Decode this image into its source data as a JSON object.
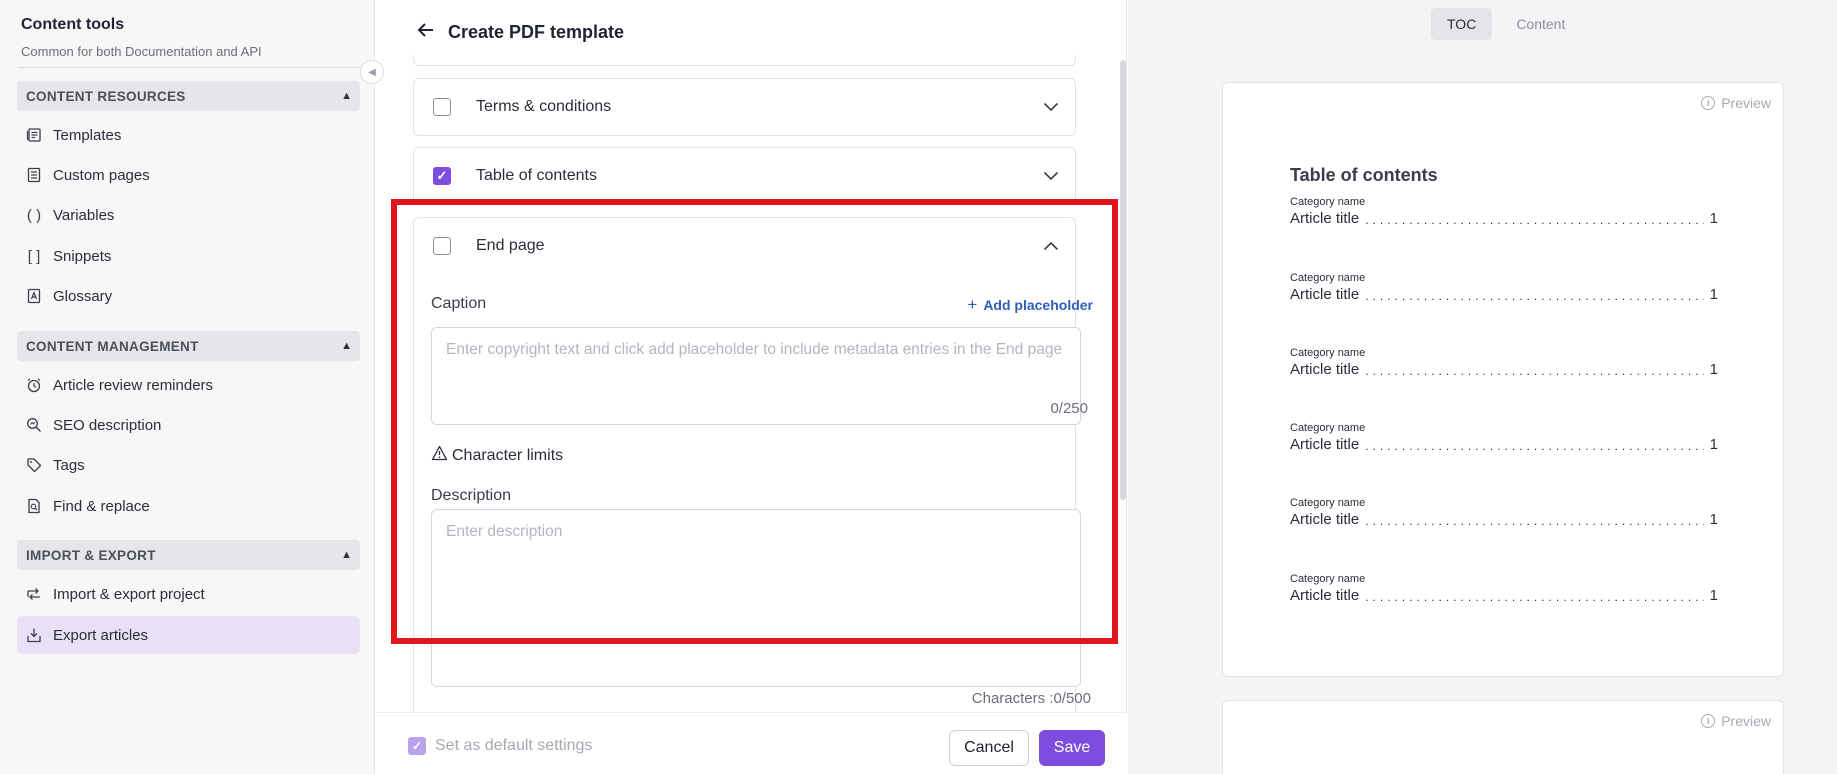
{
  "sidebar": {
    "title": "Content tools",
    "subtitle": "Common for both Documentation and API",
    "sections": [
      {
        "label": "CONTENT RESOURCES",
        "items": [
          "Templates",
          "Custom pages",
          "Variables",
          "Snippets",
          "Glossary"
        ]
      },
      {
        "label": "CONTENT MANAGEMENT",
        "items": [
          "Article review reminders",
          "SEO description",
          "Tags",
          "Find & replace"
        ]
      },
      {
        "label": "IMPORT & EXPORT",
        "items": [
          "Import & export project",
          "Export articles"
        ]
      }
    ],
    "active_item": "Export articles"
  },
  "editor": {
    "title": "Create PDF template",
    "sections": [
      {
        "label": "Terms & conditions",
        "checked": false,
        "expanded": false
      },
      {
        "label": "Table of contents",
        "checked": true,
        "expanded": false
      },
      {
        "label": "End page",
        "checked": false,
        "expanded": true
      }
    ],
    "end_page": {
      "caption_label": "Caption",
      "add_placeholder": "Add placeholder",
      "caption_placeholder": "Enter copyright text and click add placeholder to include metadata entries in the End page",
      "caption_counter": "0/250",
      "char_limits": "Character limits",
      "description_label": "Description",
      "description_placeholder": "Enter description",
      "description_counter": "Characters :0/500"
    },
    "footer": {
      "default_label": "Set as default settings",
      "cancel": "Cancel",
      "save": "Save"
    }
  },
  "preview": {
    "tabs": [
      "TOC",
      "Content"
    ],
    "active_tab": "TOC",
    "preview_label": "Preview",
    "toc_title": "Table of contents",
    "entries": [
      {
        "category": "Category name",
        "title": "Article title",
        "page": "1"
      },
      {
        "category": "Category name",
        "title": "Article title",
        "page": "1"
      },
      {
        "category": "Category name",
        "title": "Article title",
        "page": "1"
      },
      {
        "category": "Category name",
        "title": "Article title",
        "page": "1"
      },
      {
        "category": "Category name",
        "title": "Article title",
        "page": "1"
      },
      {
        "category": "Category name",
        "title": "Article title",
        "page": "1"
      }
    ]
  },
  "colors": {
    "accent": "#7c4dde",
    "link": "#2e5fb8",
    "highlight": "#e0171e"
  }
}
